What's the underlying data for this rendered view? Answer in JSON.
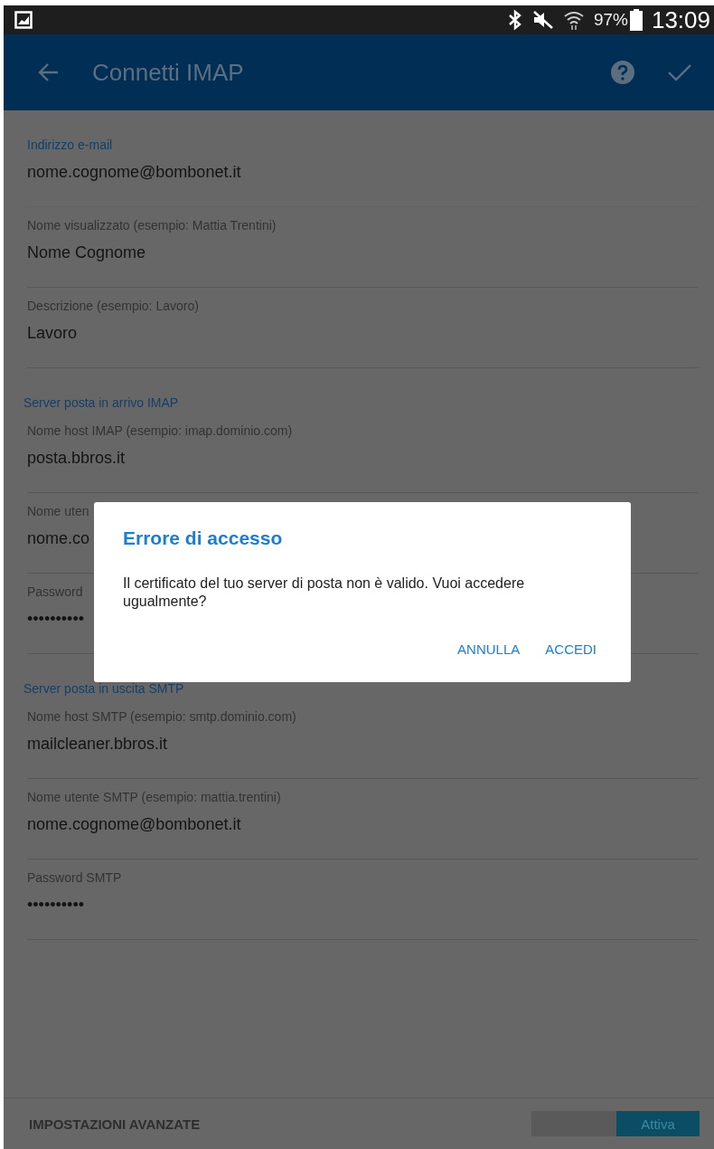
{
  "status_bar": {
    "battery": "97%",
    "time": "13:09"
  },
  "app_bar": {
    "title": "Connetti IMAP"
  },
  "sections": [
    {
      "fields": [
        {
          "label": "Indirizzo e-mail",
          "value": "nome.cognome@bombonet.it",
          "focused": true
        },
        {
          "label": "Nome visualizzato (esempio: Mattia Trentini)",
          "value": "Nome Cognome",
          "focused": false
        },
        {
          "label": "Descrizione (esempio: Lavoro)",
          "value": "Lavoro",
          "focused": false
        }
      ]
    },
    {
      "heading": "Server posta in arrivo IMAP",
      "fields": [
        {
          "label": "Nome host IMAP (esempio: imap.dominio.com)",
          "value": "posta.bbros.it",
          "focused": false
        },
        {
          "label": "Nome uten",
          "value": "nome.co",
          "focused": false
        },
        {
          "label": "Password",
          "value": "••••••••••",
          "focused": false
        }
      ]
    },
    {
      "heading": "Server posta in uscita SMTP",
      "fields": [
        {
          "label": "Nome host SMTP (esempio: smtp.dominio.com)",
          "value": "mailcleaner.bbros.it",
          "focused": false
        },
        {
          "label": "Nome utente SMTP (esempio: mattia.trentini)",
          "value": "nome.cognome@bombonet.it",
          "focused": false
        },
        {
          "label": "Password SMTP",
          "value": "••••••••••",
          "focused": false
        }
      ]
    }
  ],
  "footer": {
    "label": "IMPOSTAZIONI AVANZATE",
    "toggle": {
      "label": "Attiva",
      "on": true
    }
  },
  "dialog": {
    "title": "Errore di accesso",
    "message": "Il certificato del tuo server di posta non è valido. Vuoi accedere ugualmente?",
    "buttons": [
      "ANNULLA",
      "ACCEDI"
    ]
  }
}
